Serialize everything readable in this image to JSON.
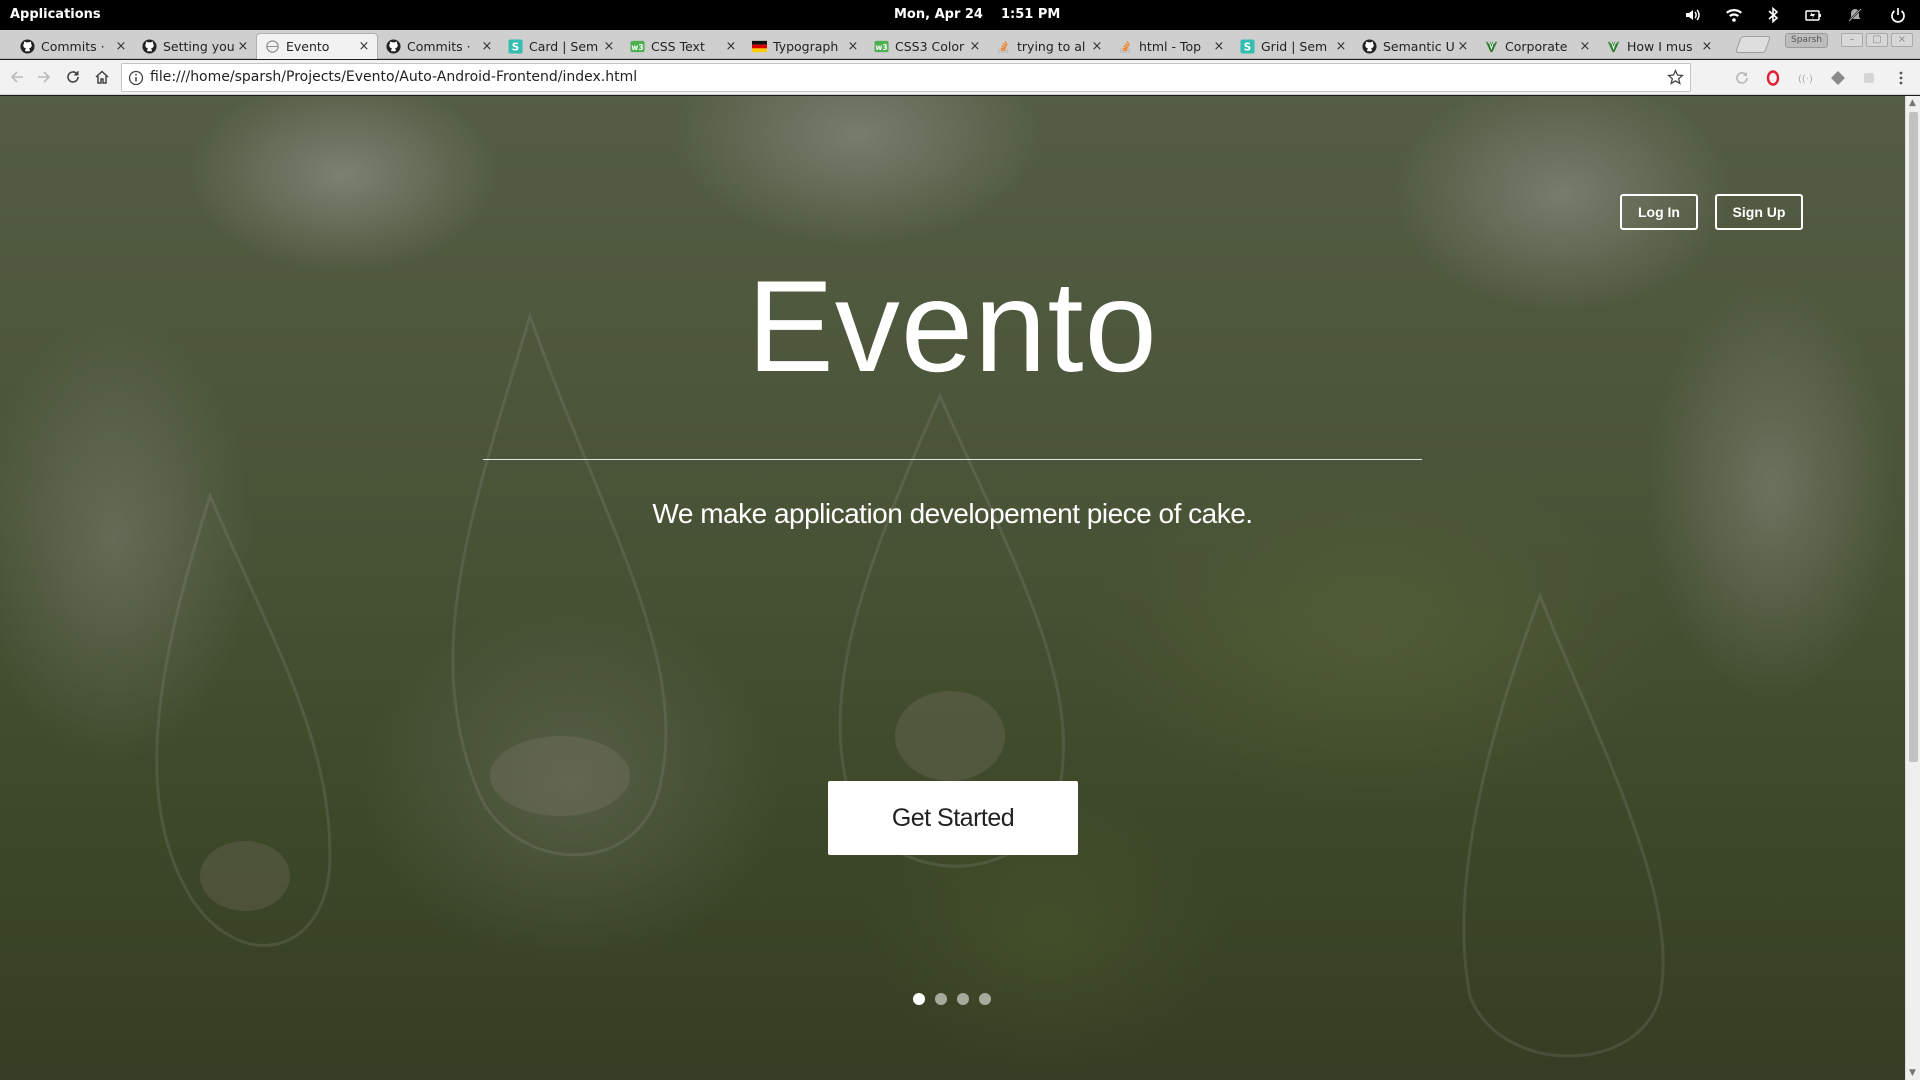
{
  "os": {
    "apps_label": "Applications",
    "date": "Mon, Apr 24",
    "time": "1:51 PM",
    "tray_icons": [
      "volume-icon",
      "wifi-icon",
      "bluetooth-icon",
      "battery-icon",
      "notifications-off-icon",
      "power-icon"
    ]
  },
  "browser": {
    "tabs": [
      {
        "label": "Commits ·",
        "favicon": "github-icon",
        "active": false
      },
      {
        "label": "Setting you",
        "favicon": "github-icon",
        "active": false
      },
      {
        "label": "Evento",
        "favicon": "page-icon",
        "active": true
      },
      {
        "label": "Commits ·",
        "favicon": "github-icon",
        "active": false
      },
      {
        "label": "Card | Sem",
        "favicon": "semantic-ui-icon",
        "active": false
      },
      {
        "label": "CSS Text",
        "favicon": "w3schools-icon",
        "active": false
      },
      {
        "label": "Typograph",
        "favicon": "flag-icon",
        "active": false
      },
      {
        "label": "CSS3 Color",
        "favicon": "w3schools-icon",
        "active": false
      },
      {
        "label": "trying to al",
        "favicon": "stackoverflow-icon",
        "active": false
      },
      {
        "label": "html - Top",
        "favicon": "stackoverflow-icon",
        "active": false
      },
      {
        "label": "Grid | Sem",
        "favicon": "semantic-ui-icon",
        "active": false
      },
      {
        "label": "Semantic U",
        "favicon": "github-icon",
        "active": false
      },
      {
        "label": "Corporate",
        "favicon": "v-logo-icon",
        "active": false
      },
      {
        "label": "How I mus",
        "favicon": "v-logo-icon",
        "active": false
      }
    ],
    "tab_close_glyph": "×",
    "profile_label": "Sparsh",
    "url": "file:///home/sparsh/Projects/Evento/Auto-Android-Frontend/index.html",
    "extensions": [
      "reload-ext-icon",
      "opera-icon",
      "cast-icon",
      "shield-ext-icon",
      "puzzle-ext-icon",
      "menu-icon"
    ]
  },
  "page": {
    "login_label": "Log In",
    "signup_label": "Sign Up",
    "title": "Evento",
    "tagline": "We make application developement piece of cake.",
    "cta_label": "Get Started",
    "carousel": {
      "count": 4,
      "active_index": 0
    }
  }
}
